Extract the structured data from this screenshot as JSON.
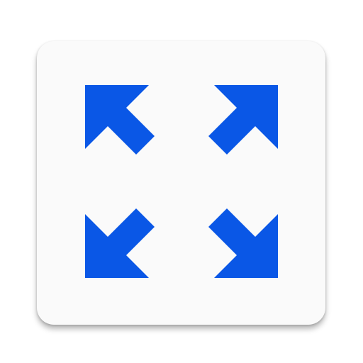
{
  "app_icon": {
    "name": "fullscreen-expand",
    "icon": "expand-arrows-icon",
    "background_color": "#fafafa",
    "glyph_color": "#0a57e6"
  },
  "arrows": [
    {
      "id": "top-left",
      "icon": "arrow-up-left-icon"
    },
    {
      "id": "top-right",
      "icon": "arrow-up-right-icon"
    },
    {
      "id": "bottom-left",
      "icon": "arrow-down-left-icon"
    },
    {
      "id": "bottom-right",
      "icon": "arrow-down-right-icon"
    }
  ]
}
